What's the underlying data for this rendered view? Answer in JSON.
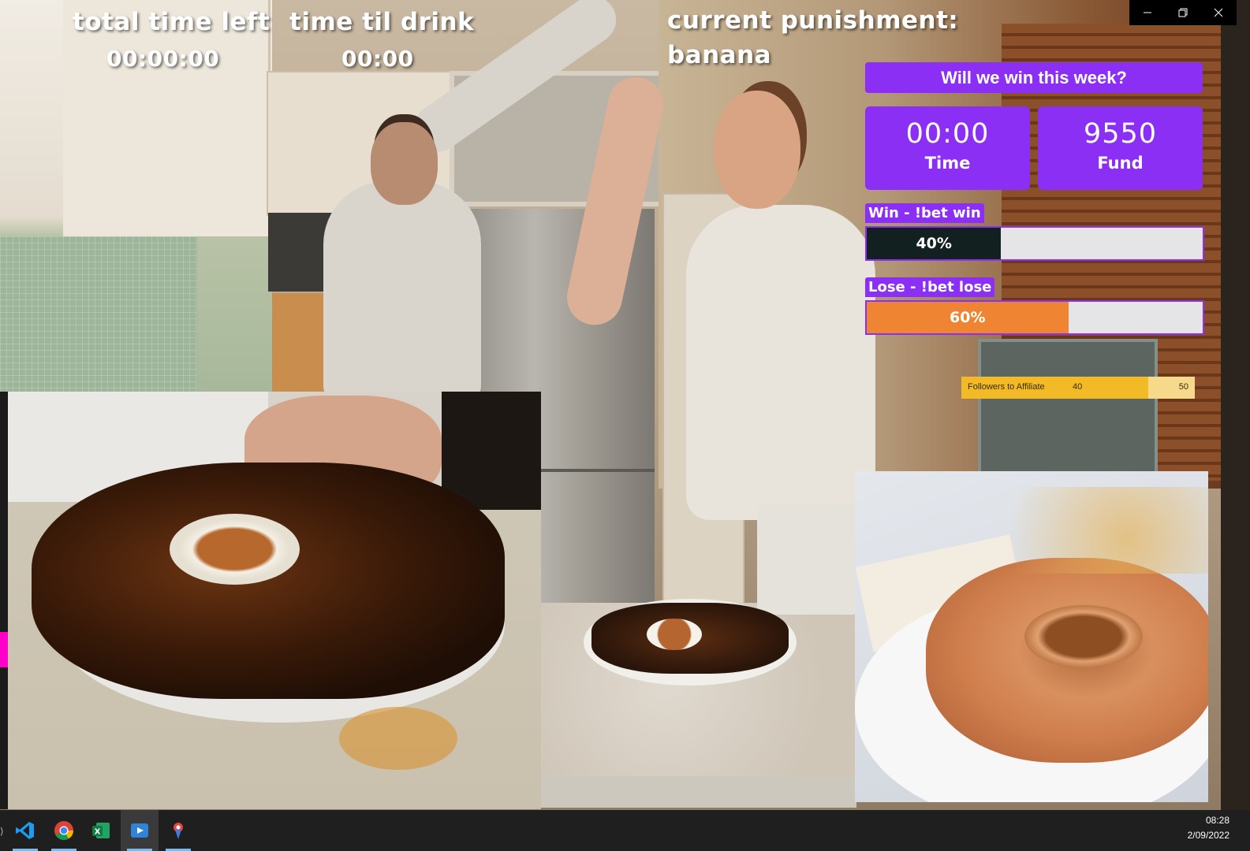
{
  "overlay": {
    "total_time_label": "total time left",
    "total_time_value": "00:00:00",
    "drink_label": "time til drink",
    "drink_value": "00:00",
    "punishment_label": "current punishment:",
    "punishment_value": "banana"
  },
  "bet": {
    "title": "Will we win this week?",
    "time_value": "00:00",
    "time_label": "Time",
    "fund_value": "9550",
    "fund_label": "Fund",
    "win_label": "Win - !bet win",
    "win_percent_text": "40%",
    "win_fraction": 0.4,
    "lose_label": "Lose - !bet lose",
    "lose_percent_text": "60%",
    "lose_fraction": 0.6,
    "colors": {
      "panel": "#8b2ff5",
      "win_fill": "#12211f",
      "lose_fill": "#ef8433"
    }
  },
  "followers": {
    "label": "Followers to Affiliate",
    "current": "40",
    "goal": "50",
    "fraction": 0.8
  },
  "window": {
    "minimize": "minimize-icon",
    "restore": "restore-icon",
    "close": "close-icon"
  },
  "taskbar": {
    "apps": [
      "vscode-icon",
      "chrome-icon",
      "excel-icon",
      "media-player-icon",
      "app-icon"
    ],
    "time": "08:28",
    "date": "2/09/2022"
  }
}
